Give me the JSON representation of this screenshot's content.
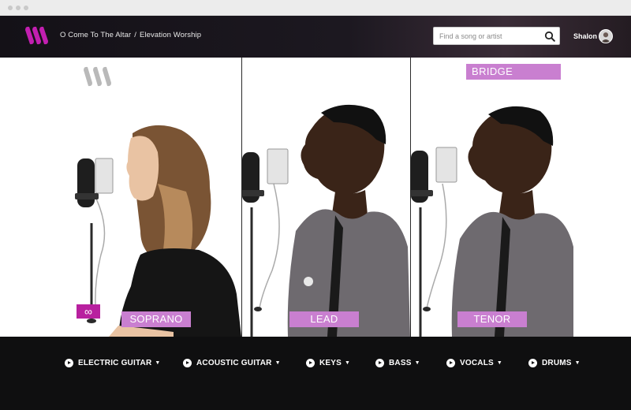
{
  "header": {
    "song_title": "O Come To The Altar",
    "separator": "/",
    "artist": "Elevation Worship",
    "search_placeholder": "Find a song or artist",
    "user_name": "Shalon"
  },
  "parts": {
    "section_label": "BRIDGE",
    "loop_symbol": "∞",
    "voices": [
      "SOPRANO",
      "LEAD",
      "TENOR"
    ]
  },
  "instruments": [
    {
      "label": "ELECTRIC GUITAR",
      "caret": "▼"
    },
    {
      "label": "ACOUSTIC GUITAR",
      "caret": "▼"
    },
    {
      "label": "KEYS",
      "caret": "▼"
    },
    {
      "label": "BASS",
      "caret": "▼"
    },
    {
      "label": "VOCALS",
      "caret": "▼"
    },
    {
      "label": "DRUMS",
      "caret": "▼"
    }
  ],
  "colors": {
    "accent": "#c97fd0",
    "loop_badge": "#b8209f",
    "brand_logo": "#c21fb0",
    "topbar": "#141117",
    "bottombar": "#0f0f10"
  },
  "icons": {
    "logo": "multitracks-logo-icon",
    "search": "search-icon",
    "avatar": "user-avatar",
    "play": "play-icon"
  }
}
